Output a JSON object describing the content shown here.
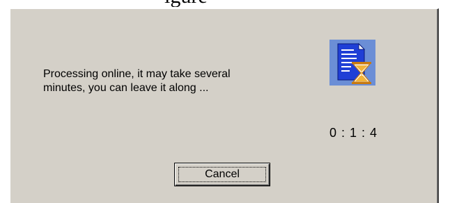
{
  "page": {
    "heading_fragment": "igure"
  },
  "dialog": {
    "message_line1": "Processing online, it may take several",
    "message_line2": "minutes, you can leave it along ...",
    "elapsed_time": "0 : 1 : 4",
    "icon": "document-hourglass-icon",
    "cancel_label": "Cancel"
  },
  "colors": {
    "dialog_background": "#d4d0c8",
    "icon_background": "#6b8ed6",
    "document_blue": "#1f3fd6",
    "hourglass_sand": "#f2b43a"
  }
}
